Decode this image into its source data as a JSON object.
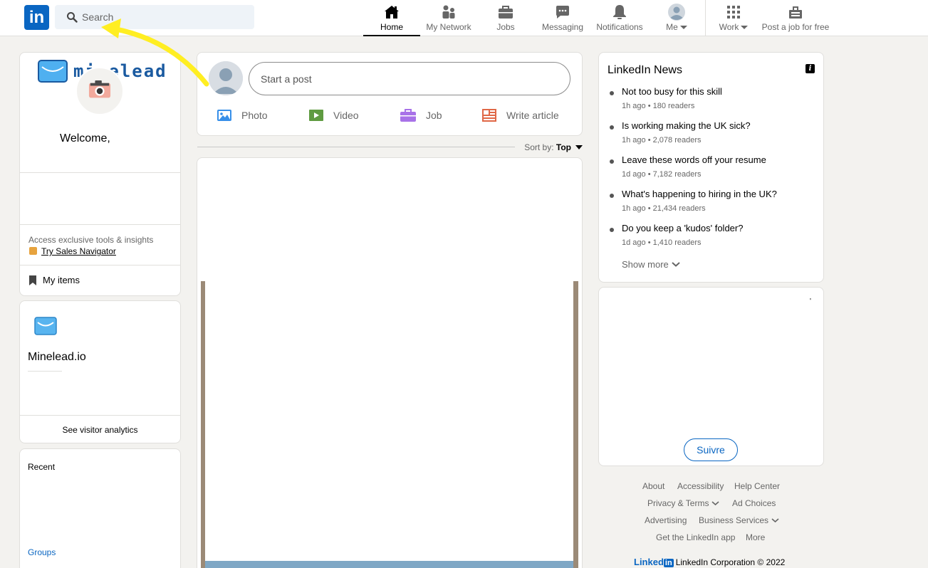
{
  "header": {
    "logo": "in",
    "search_placeholder": "Search",
    "nav": {
      "home": "Home",
      "network": "My Network",
      "jobs": "Jobs",
      "messaging": "Messaging",
      "notifications": "Notifications",
      "me": "Me",
      "work": "Work",
      "post_job": "Post a job for free"
    }
  },
  "profile": {
    "brand": "minelead",
    "welcome": "Welcome,",
    "access_text": "Access exclusive tools & insights",
    "try_label": "Try Sales Navigator",
    "my_items": "My items"
  },
  "page_card": {
    "name": "Minelead.io",
    "visitor_analytics": "See visitor analytics"
  },
  "recent_card": {
    "recent": "Recent",
    "groups": "Groups"
  },
  "share": {
    "placeholder": "Start a post",
    "photo": "Photo",
    "video": "Video",
    "job": "Job",
    "article": "Write article"
  },
  "sort": {
    "label": "Sort by:",
    "value": "Top"
  },
  "news": {
    "title": "LinkedIn News",
    "info": "i",
    "items": [
      {
        "headline": "Not too busy for this skill",
        "meta": "1h ago • 180 readers"
      },
      {
        "headline": "Is working making the UK sick?",
        "meta": "1h ago • 2,078 readers"
      },
      {
        "headline": "Leave these words off your resume",
        "meta": "1d ago • 7,182 readers"
      },
      {
        "headline": "What's happening to hiring in the UK?",
        "meta": "1h ago • 21,434 readers"
      },
      {
        "headline": "Do you keep a 'kudos' folder?",
        "meta": "1d ago • 1,410 readers"
      }
    ],
    "show_more": "Show more"
  },
  "ad": {
    "tick": "'",
    "follow": "Suivre"
  },
  "footer": {
    "about": "About",
    "accessibility": "Accessibility",
    "help": "Help Center",
    "privacy": "Privacy & Terms",
    "adchoices": "Ad Choices",
    "advertising": "Advertising",
    "business": "Business Services",
    "getapp": "Get the LinkedIn app",
    "more": "More",
    "brand_word": "Linked",
    "brand_box": "in",
    "copyright": "LinkedIn Corporation © 2022"
  },
  "colors": {
    "accent": "#0a66c2",
    "annotation_arrow": "#ffee22",
    "background": "#f3f2ef"
  }
}
